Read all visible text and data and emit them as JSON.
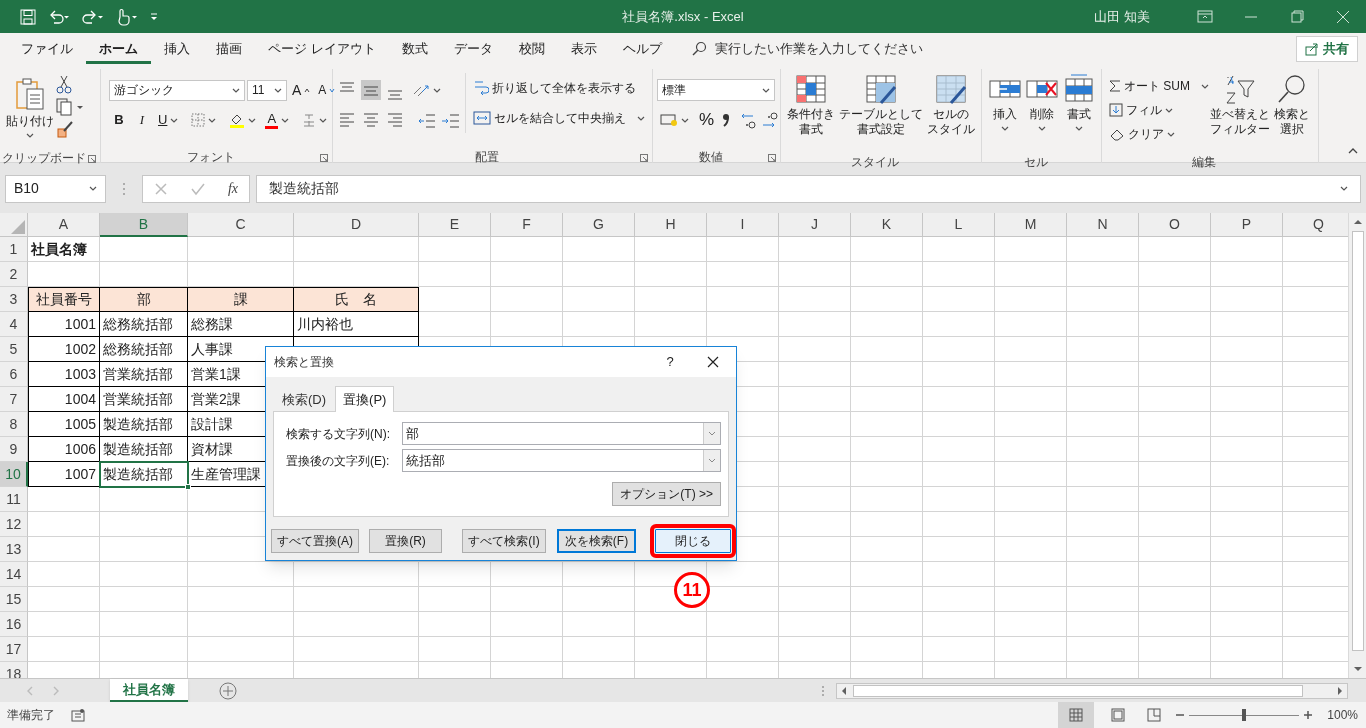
{
  "title_bar": {
    "title": "社員名簿.xlsx  -  Excel",
    "user": "山田 知美"
  },
  "menu_tabs": [
    {
      "label": "ファイル",
      "selected": false
    },
    {
      "label": "ホーム",
      "selected": true
    },
    {
      "label": "挿入",
      "selected": false
    },
    {
      "label": "描画",
      "selected": false
    },
    {
      "label": "ページ レイアウト",
      "selected": false
    },
    {
      "label": "数式",
      "selected": false
    },
    {
      "label": "データ",
      "selected": false
    },
    {
      "label": "校閲",
      "selected": false
    },
    {
      "label": "表示",
      "selected": false
    },
    {
      "label": "ヘルプ",
      "selected": false
    }
  ],
  "tell_me": {
    "placeholder": "実行したい作業を入力してください"
  },
  "share_button": "共有",
  "ribbon": {
    "clipboard": {
      "label": "クリップボード",
      "paste": "貼り付け"
    },
    "font": {
      "label": "フォント",
      "font_name": "游ゴシック",
      "font_size": "11",
      "grow": "A",
      "shrink": "A",
      "bold": "B",
      "italic": "I",
      "underline": "U",
      "font_color": "A"
    },
    "alignment": {
      "label": "配置",
      "wrap": "折り返して全体を表示する",
      "merge": "セルを結合して中央揃え"
    },
    "number": {
      "label": "数値",
      "format": "標準",
      "percent": "%"
    },
    "styles": {
      "label": "スタイル",
      "buttons": [
        [
          "条件付き",
          "書式"
        ],
        [
          "テーブルとして",
          "書式設定"
        ],
        [
          "セルの",
          "スタイル"
        ]
      ]
    },
    "cells": {
      "label": "セル",
      "buttons": [
        "挿入",
        "削除",
        "書式"
      ]
    },
    "editing": {
      "label": "編集",
      "autosum": "オート SUM",
      "fill": "フィル",
      "clear": "クリア",
      "sort": [
        "並べ替えと",
        "フィルター"
      ],
      "find": [
        "検索と",
        "選択"
      ]
    }
  },
  "formula_bar": {
    "name_box": "B10",
    "fx": "fx",
    "formula": "製造統括部"
  },
  "sheet": {
    "columns": [
      {
        "label": "A",
        "selected": false
      },
      {
        "label": "B",
        "selected": true
      },
      {
        "label": "C",
        "selected": false
      },
      {
        "label": "D",
        "selected": false
      },
      {
        "label": "E",
        "selected": false
      },
      {
        "label": "F",
        "selected": false
      },
      {
        "label": "G",
        "selected": false
      },
      {
        "label": "H",
        "selected": false
      },
      {
        "label": "I",
        "selected": false
      },
      {
        "label": "J",
        "selected": false
      },
      {
        "label": "K",
        "selected": false
      },
      {
        "label": "L",
        "selected": false
      },
      {
        "label": "M",
        "selected": false
      },
      {
        "label": "N",
        "selected": false
      },
      {
        "label": "O",
        "selected": false
      },
      {
        "label": "P",
        "selected": false
      },
      {
        "label": "Q",
        "selected": false
      }
    ],
    "rows": [
      {
        "number": "1",
        "selected": false,
        "kind": "title",
        "cells": [
          "社員名簿"
        ]
      },
      {
        "number": "2",
        "selected": false,
        "kind": "empty",
        "cells": []
      },
      {
        "number": "3",
        "selected": false,
        "kind": "header",
        "cells": [
          "社員番号",
          "部",
          "課",
          "氏　名"
        ]
      },
      {
        "number": "4",
        "selected": false,
        "kind": "data",
        "cells": [
          "1001",
          "総務統括部",
          "総務課",
          "川内裕也"
        ]
      },
      {
        "number": "5",
        "selected": false,
        "kind": "data",
        "cells": [
          "1002",
          "総務統括部",
          "人事課"
        ]
      },
      {
        "number": "6",
        "selected": false,
        "kind": "data",
        "cells": [
          "1003",
          "営業統括部",
          "営業1課"
        ]
      },
      {
        "number": "7",
        "selected": false,
        "kind": "data",
        "cells": [
          "1004",
          "営業統括部",
          "営業2課"
        ]
      },
      {
        "number": "8",
        "selected": false,
        "kind": "data",
        "cells": [
          "1005",
          "製造統括部",
          "設計課"
        ]
      },
      {
        "number": "9",
        "selected": false,
        "kind": "data",
        "cells": [
          "1006",
          "製造統括部",
          "資材課"
        ]
      },
      {
        "number": "10",
        "selected": true,
        "kind": "data",
        "cells": [
          "1007",
          "製造統括部",
          "生産管理課"
        ]
      },
      {
        "number": "11",
        "selected": false,
        "kind": "empty",
        "cells": []
      },
      {
        "number": "12",
        "selected": false,
        "kind": "empty",
        "cells": []
      },
      {
        "number": "13",
        "selected": false,
        "kind": "empty",
        "cells": []
      },
      {
        "number": "14",
        "selected": false,
        "kind": "empty",
        "cells": []
      },
      {
        "number": "15",
        "selected": false,
        "kind": "empty",
        "cells": []
      },
      {
        "number": "16",
        "selected": false,
        "kind": "empty",
        "cells": []
      },
      {
        "number": "17",
        "selected": false,
        "kind": "empty",
        "cells": []
      },
      {
        "number": "18",
        "selected": false,
        "kind": "empty",
        "cells": []
      }
    ]
  },
  "sheet_tabs": [
    {
      "label": "社員名簿",
      "selected": true
    }
  ],
  "status_bar": {
    "status": "準備完了",
    "zoom": "100%",
    "zoom_slider": {
      "level": 0.5
    }
  },
  "dialog": {
    "title": "検索と置換",
    "help": "?",
    "tabs": [
      {
        "label": "検索(D)",
        "selected": false
      },
      {
        "label": "置換(P)",
        "selected": true
      }
    ],
    "fields": [
      {
        "label": "検索する文字列(N):",
        "value": "部"
      },
      {
        "label": "置換後の文字列(E):",
        "value": "統括部"
      }
    ],
    "options_button": "オプション(T) >>",
    "buttons": [
      {
        "label": "すべて置換(A)",
        "kind": "normal"
      },
      {
        "label": "置換(R)",
        "kind": "normal"
      },
      {
        "label": "すべて検索(I)",
        "kind": "normal"
      },
      {
        "label": "次を検索(F)",
        "kind": "default"
      },
      {
        "label": "閉じる",
        "kind": "highlighted"
      }
    ]
  },
  "annotation": {
    "label": "11"
  }
}
